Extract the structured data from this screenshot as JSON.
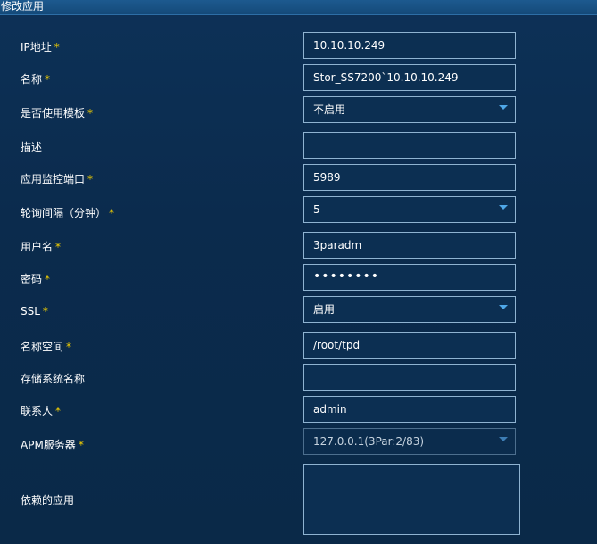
{
  "dialog": {
    "title": "修改应用"
  },
  "required_mark": "*",
  "fields": [
    {
      "label": "IP地址",
      "required": true,
      "type": "text",
      "value": "10.10.10.249"
    },
    {
      "label": "名称",
      "required": true,
      "type": "text",
      "value": "Stor_SS7200`10.10.10.249"
    },
    {
      "label": "是否使用模板",
      "required": true,
      "type": "select",
      "value": "不启用"
    },
    {
      "label": "描述",
      "required": false,
      "type": "text",
      "value": ""
    },
    {
      "label": "应用监控端口",
      "required": true,
      "type": "text",
      "value": "5989"
    },
    {
      "label": "轮询间隔（分钟）",
      "required": true,
      "type": "select",
      "value": "5"
    },
    {
      "label": "用户名",
      "required": true,
      "type": "text",
      "value": "3paradm"
    },
    {
      "label": "密码",
      "required": true,
      "type": "password",
      "value": "••••••••"
    },
    {
      "label": "SSL",
      "required": true,
      "type": "select",
      "value": "启用"
    },
    {
      "label": "名称空间",
      "required": true,
      "type": "text",
      "value": "/root/tpd"
    },
    {
      "label": "存储系统名称",
      "required": false,
      "type": "text",
      "value": ""
    },
    {
      "label": "联系人",
      "required": true,
      "type": "text",
      "value": "admin"
    },
    {
      "label": "APM服务器",
      "required": true,
      "type": "select",
      "value": "127.0.0.1(3Par:2/83)",
      "disabled": true
    },
    {
      "label": "依赖的应用",
      "required": false,
      "type": "textarea",
      "value": ""
    }
  ]
}
